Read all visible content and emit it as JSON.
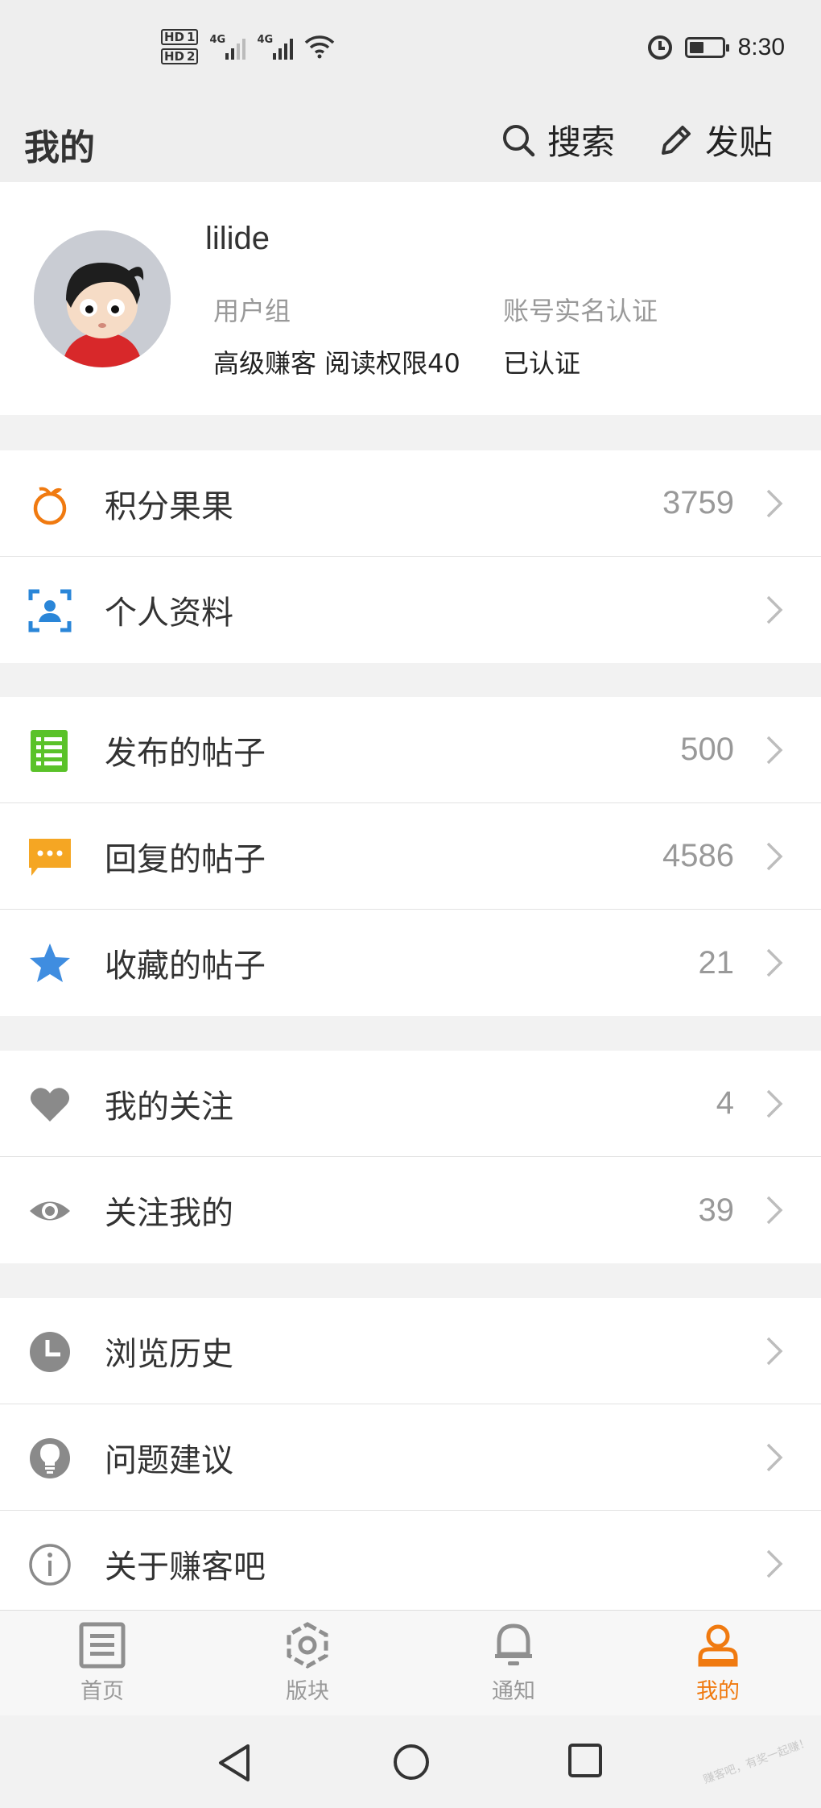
{
  "status_bar": {
    "hd1": "HD",
    "hd1_num": "1",
    "hd2": "HD",
    "hd2_num": "2",
    "net1": "4G",
    "net2": "4G",
    "time": "8:30"
  },
  "header": {
    "title": "我的",
    "search_label": "搜索",
    "post_label": "发贴"
  },
  "profile": {
    "username": "lilide",
    "group_label": "用户组",
    "group_value": "高级赚客 阅读权限40",
    "verify_label": "账号实名认证",
    "verify_value": "已认证"
  },
  "menu": {
    "points": {
      "label": "积分果果",
      "count": "3759",
      "icon": "orange-icon",
      "color": "#f07a10"
    },
    "profile_info": {
      "label": "个人资料",
      "icon": "profile-card-icon",
      "color": "#2a86d8"
    },
    "my_posts": {
      "label": "发布的帖子",
      "count": "500",
      "icon": "list-icon",
      "color": "#5ac229"
    },
    "my_replies": {
      "label": "回复的帖子",
      "count": "4586",
      "icon": "chat-bubble-icon",
      "color": "#f5a623"
    },
    "favorites": {
      "label": "收藏的帖子",
      "count": "21",
      "icon": "star-icon",
      "color": "#3f8de0"
    },
    "following": {
      "label": "我的关注",
      "count": "4",
      "icon": "heart-icon",
      "color": "#8a8a8a"
    },
    "followers": {
      "label": "关注我的",
      "count": "39",
      "icon": "eye-icon",
      "color": "#8a8a8a"
    },
    "history": {
      "label": "浏览历史",
      "icon": "clock-icon",
      "color": "#8a8a8a"
    },
    "feedback": {
      "label": "问题建议",
      "icon": "lightbulb-icon",
      "color": "#8a8a8a"
    },
    "about": {
      "label": "关于赚客吧",
      "icon": "info-icon",
      "color": "#8a8a8a"
    }
  },
  "tabbar": {
    "home": "首页",
    "boards": "版块",
    "notify": "通知",
    "mine": "我的",
    "active": "mine",
    "active_color": "#f07a10"
  },
  "watermark": "赚客吧，有奖一起赚！"
}
